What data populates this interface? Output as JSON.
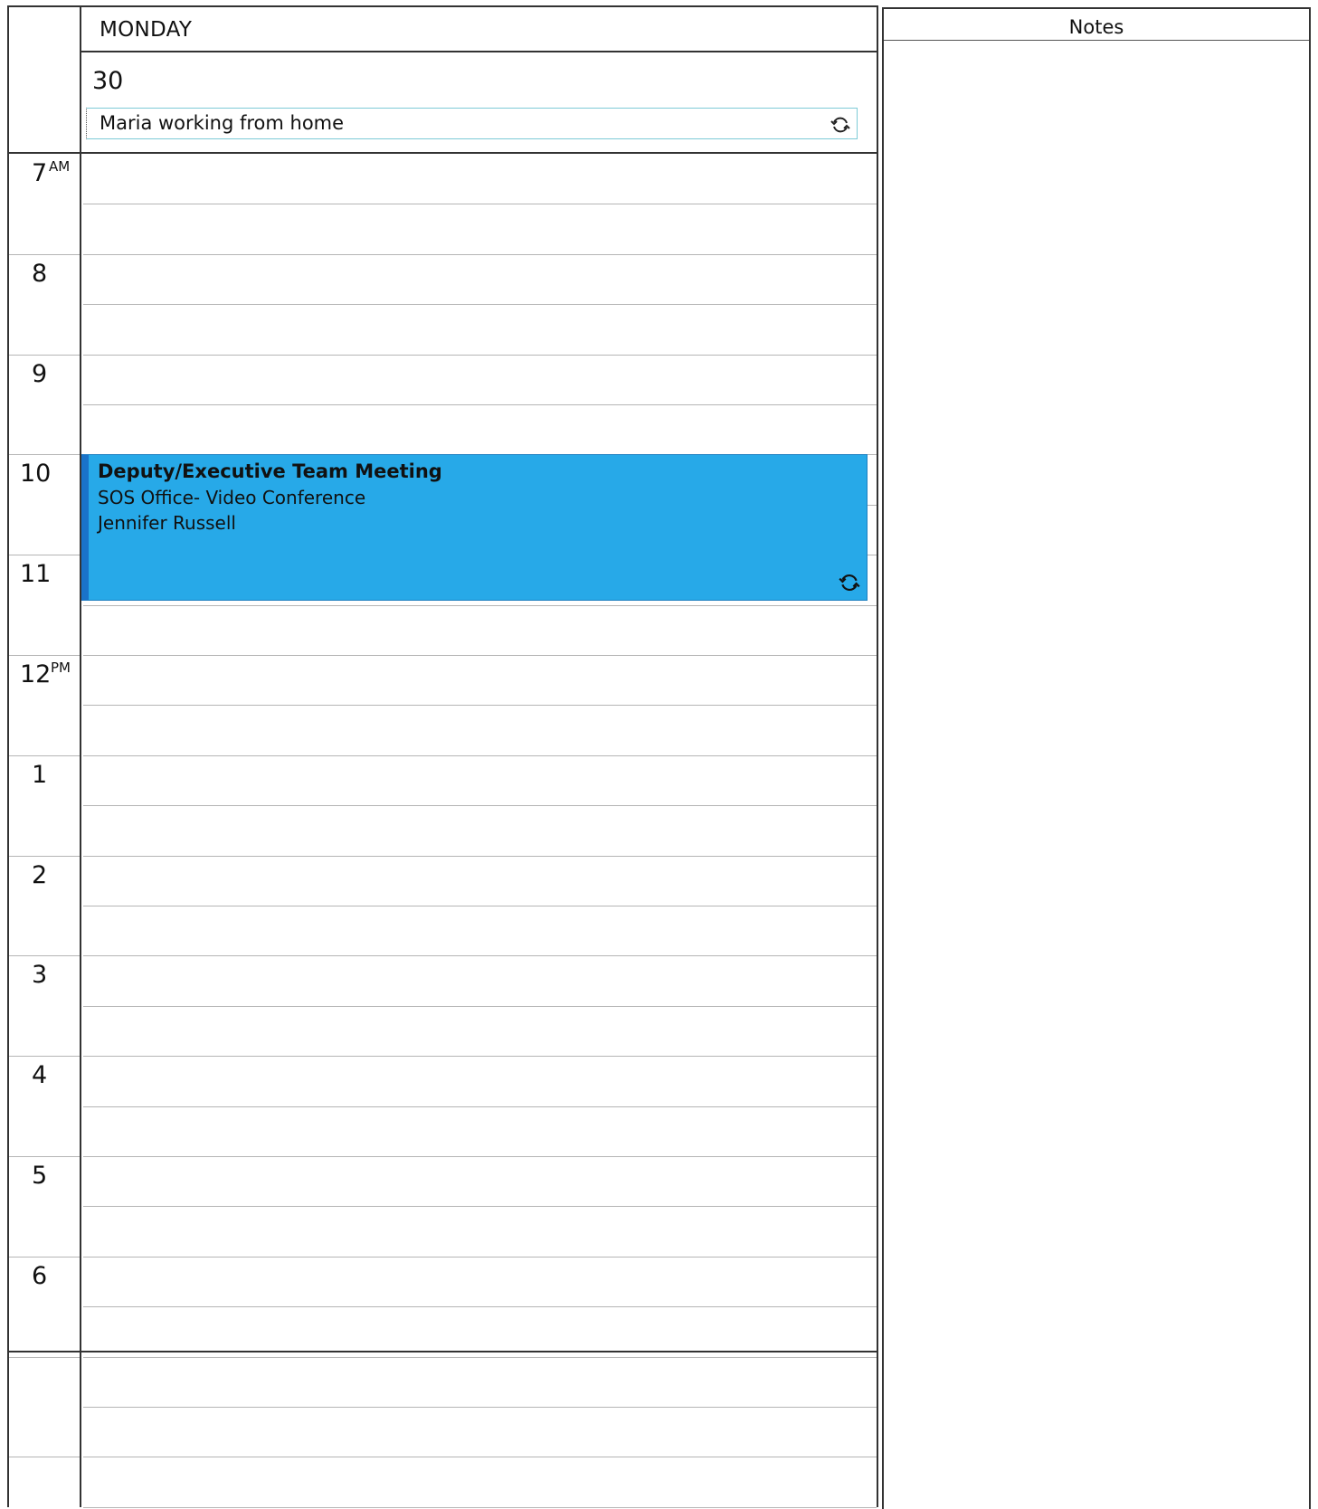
{
  "day": {
    "name": "MONDAY",
    "date": "30"
  },
  "all_day_event": {
    "title": "Maria working from home",
    "icon": "recurrence-icon"
  },
  "hours": [
    {
      "label": "7",
      "suffix": "AM"
    },
    {
      "label": "8"
    },
    {
      "label": "9"
    },
    {
      "label": "10"
    },
    {
      "label": "11"
    },
    {
      "label": "12",
      "suffix": "PM"
    },
    {
      "label": "1"
    },
    {
      "label": "2"
    },
    {
      "label": "3"
    },
    {
      "label": "4"
    },
    {
      "label": "5"
    },
    {
      "label": "6"
    }
  ],
  "appointment": {
    "title": "Deputy/Executive Team Meeting",
    "location": "SOS Office- Video Conference",
    "organizer": "Jennifer Russell",
    "color": "#27a9e8",
    "icon": "recurrence-icon"
  },
  "notes": {
    "title": "Notes"
  }
}
